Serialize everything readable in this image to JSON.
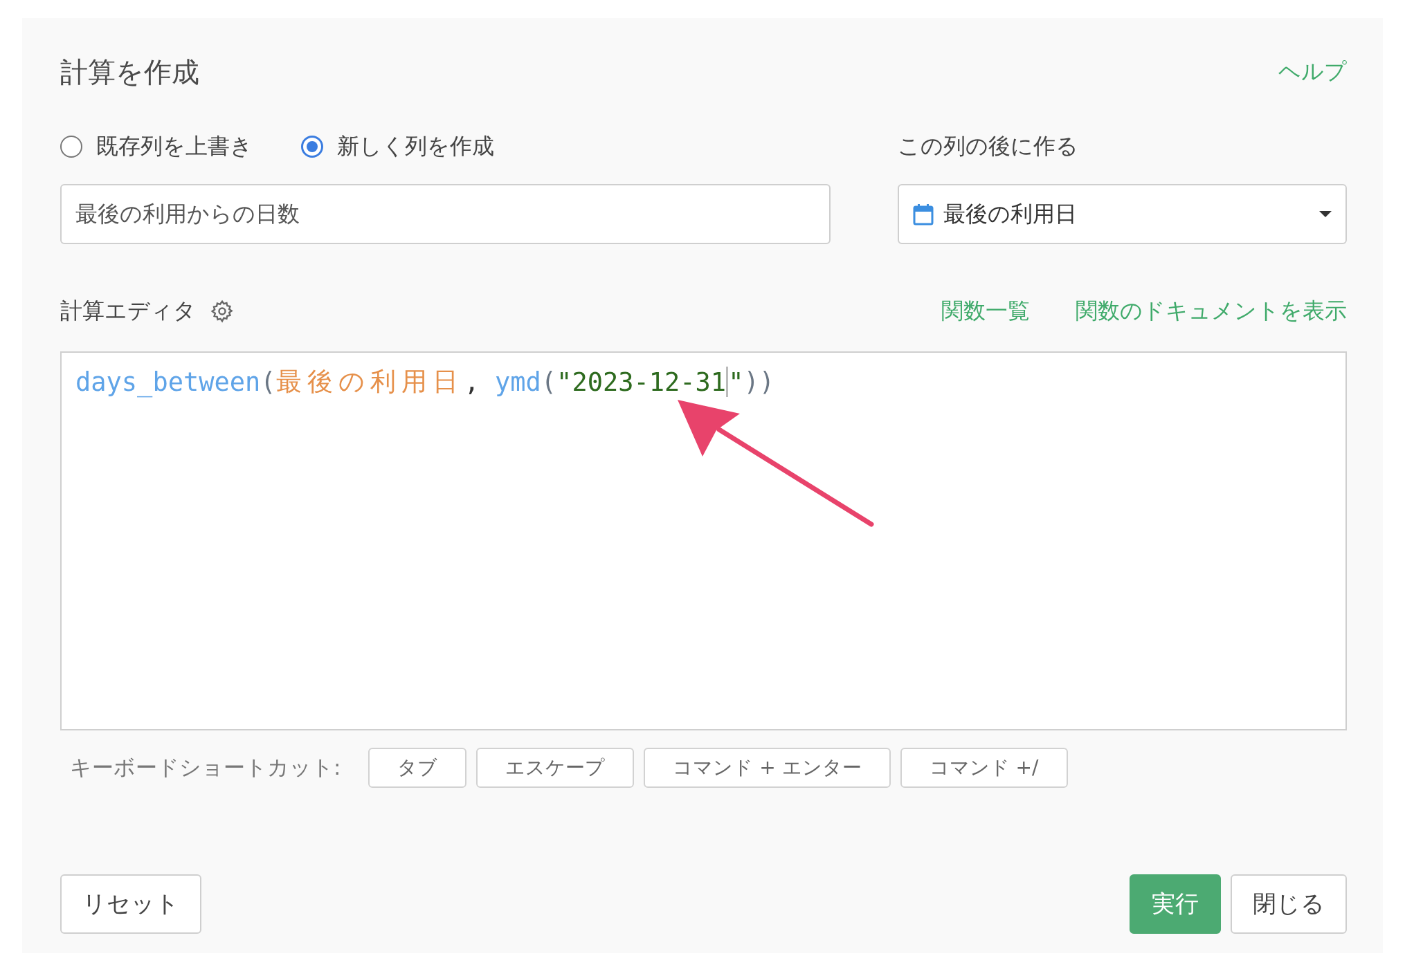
{
  "dialog": {
    "title": "計算を作成",
    "help_link": "ヘルプ"
  },
  "mode_options": [
    {
      "label": "既存列を上書き",
      "selected": false
    },
    {
      "label": "新しく列を作成",
      "selected": true
    }
  ],
  "new_column": {
    "value": "最後の利用からの日数"
  },
  "position": {
    "label": "この列の後に作る",
    "value": "最後の利用日"
  },
  "editor": {
    "label": "計算エディタ",
    "links": [
      "関数一覧",
      "関数のドキュメントを表示"
    ],
    "tokens": [
      {
        "kind": "function",
        "text": "days_between"
      },
      {
        "kind": "punct",
        "text": "("
      },
      {
        "kind": "column",
        "text": "最後の利用日"
      },
      {
        "kind": "plain",
        "text": ", "
      },
      {
        "kind": "function",
        "text": "ymd"
      },
      {
        "kind": "punct",
        "text": "("
      },
      {
        "kind": "string",
        "text": "\"2023-12-31"
      },
      {
        "kind": "cursor"
      },
      {
        "kind": "string",
        "text": "\""
      },
      {
        "kind": "punct",
        "text": "))"
      }
    ]
  },
  "shortcuts": {
    "label": "キーボードショートカット:",
    "keys": [
      "タブ",
      "エスケープ",
      "コマンド + エンター",
      "コマンド +/"
    ]
  },
  "buttons": {
    "reset": "リセット",
    "run": "実行",
    "close": "閉じる"
  }
}
